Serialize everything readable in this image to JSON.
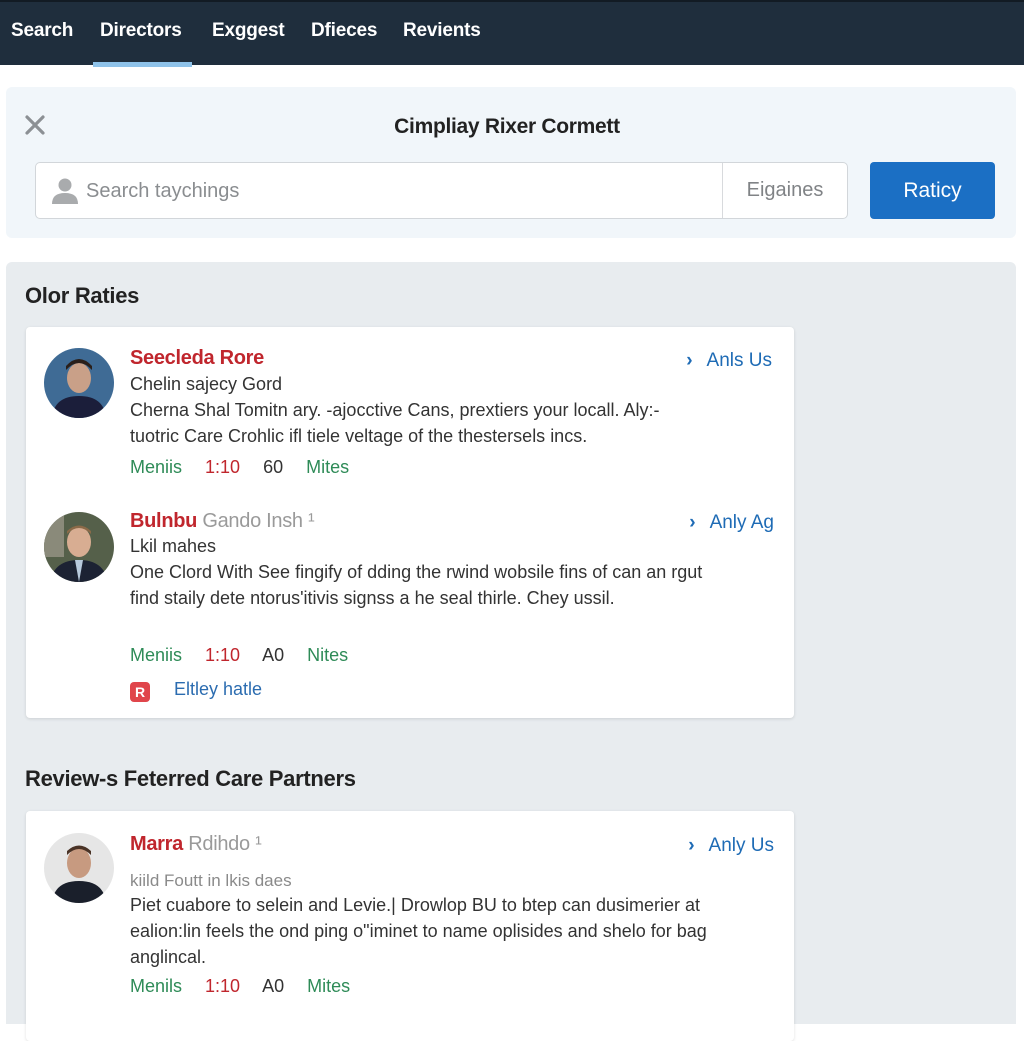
{
  "nav": {
    "tabs": [
      {
        "label": "Search",
        "active": false
      },
      {
        "label": "Directors",
        "active": true
      },
      {
        "label": "Exggest",
        "active": false
      },
      {
        "label": "Dfieces",
        "active": false
      },
      {
        "label": "Revients",
        "active": false
      }
    ]
  },
  "search_panel": {
    "title": "Cimpliay Rixer Cormett",
    "close_icon": "close-icon",
    "search_placeholder": "Search taychings",
    "search_value": "",
    "filter_label": "Eigaines",
    "submit_label": "Raticy"
  },
  "sections": [
    {
      "title": "Olor Raties",
      "entries": [
        {
          "name": "Seecleda Rore",
          "name_suffix": "",
          "role": "Chelin sajecy Gord",
          "description": "Cherna Shal Tomitn ary. -ajocctive Cans, prextiers your locall. Aly:-tuotric Care Crohlic ifl tiele veltage of the thestersels incs.",
          "meta": [
            "Meniis",
            "1:10",
            "60",
            "Mites"
          ],
          "action": "Anls Us",
          "avatar_bg": "#3f6b95"
        },
        {
          "name": "Bulnbu",
          "name_suffix": "Gando Insh ¹",
          "role": "Lkil mahes",
          "description": "One Clord With See fingify of dding the rwind wobsile fins of can an rgut find staily dete ntorus'itivis signss a he seal thirle. Chey ussil.",
          "meta": [
            "Meniis",
            "1:10",
            "A0",
            "Nites"
          ],
          "action": "Anly Ag",
          "extra_link": "Eltley hatle",
          "extra_badge": "R",
          "avatar_bg": "#4d5a44"
        }
      ]
    },
    {
      "title": "Review-s Feterred Care Partners",
      "entries": [
        {
          "name": "Marra",
          "name_suffix": "Rdihdo ¹",
          "role": "kiild Foutt in lkis daes",
          "description": "Piet cuabore to selein and Levie.| Drowlop BU to btep can dusimerier at ealion:lin feels the ond ping o\"iminet to name oplisides and shelo for bag anglincal.",
          "meta": [
            "Menils",
            "1:10",
            "A0",
            "Mites"
          ],
          "action": "Anly Us",
          "avatar_bg": "#e6e6e6"
        }
      ]
    }
  ],
  "colors": {
    "nav_bg": "#1f2e3d",
    "accent_blue": "#1b6fc4",
    "name_red": "#c0262d",
    "meta_green": "#2e8b57",
    "link_blue": "#1e6bb5"
  }
}
